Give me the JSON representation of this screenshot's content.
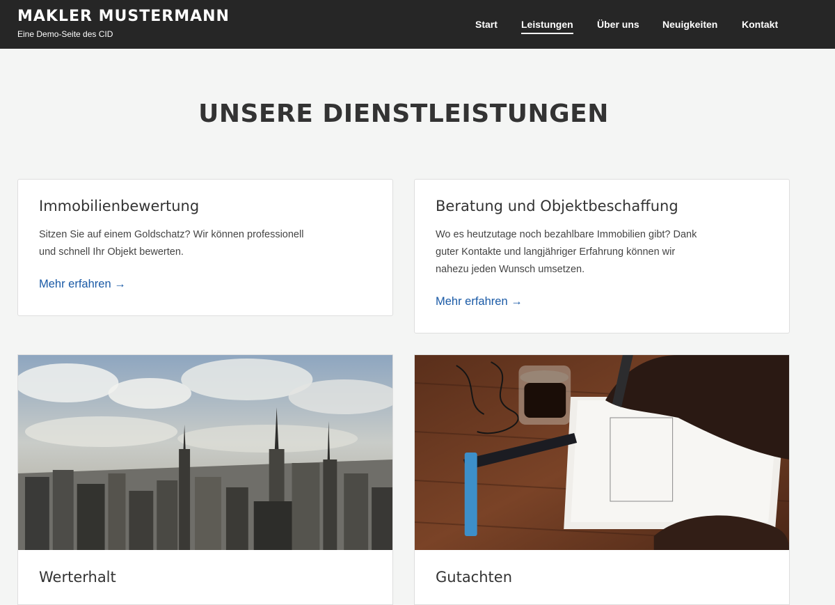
{
  "header": {
    "brand_title": "MAKLER MUSTERMANN",
    "brand_subtitle": "Eine Demo-Seite des CID",
    "nav": [
      {
        "label": "Start"
      },
      {
        "label": "Leistungen",
        "active": true
      },
      {
        "label": "Über uns"
      },
      {
        "label": "Neuigkeiten"
      },
      {
        "label": "Kontakt"
      }
    ]
  },
  "page": {
    "title": "UNSERE DIENSTLEISTUNGEN"
  },
  "cards": [
    {
      "title": "Immobilienbewertung",
      "text_lines": [
        "Sitzen Sie auf einem Goldschatz? Wir können professionell",
        "und schnell Ihr Objekt bewerten."
      ],
      "link": "Mehr erfahren →"
    },
    {
      "title": "Beratung und Objektbeschaffung",
      "text_lines": [
        "Wo es heutzutage noch bezahlbare Immobilien gibt? Dank",
        "guter Kontakte und langjähriger Erfahrung können wir",
        "nahezu jeden Wunsch umsetzen."
      ],
      "link": "Mehr erfahren →"
    }
  ],
  "image_cards": [
    {
      "title": "Werterhalt",
      "image": "city-skyline-photo"
    },
    {
      "title": "Gutachten",
      "image": "desk-drawing-photo"
    }
  ],
  "colors": {
    "header_bg": "#262626",
    "page_bg": "#f4f5f4",
    "link": "#1a5aa6"
  }
}
